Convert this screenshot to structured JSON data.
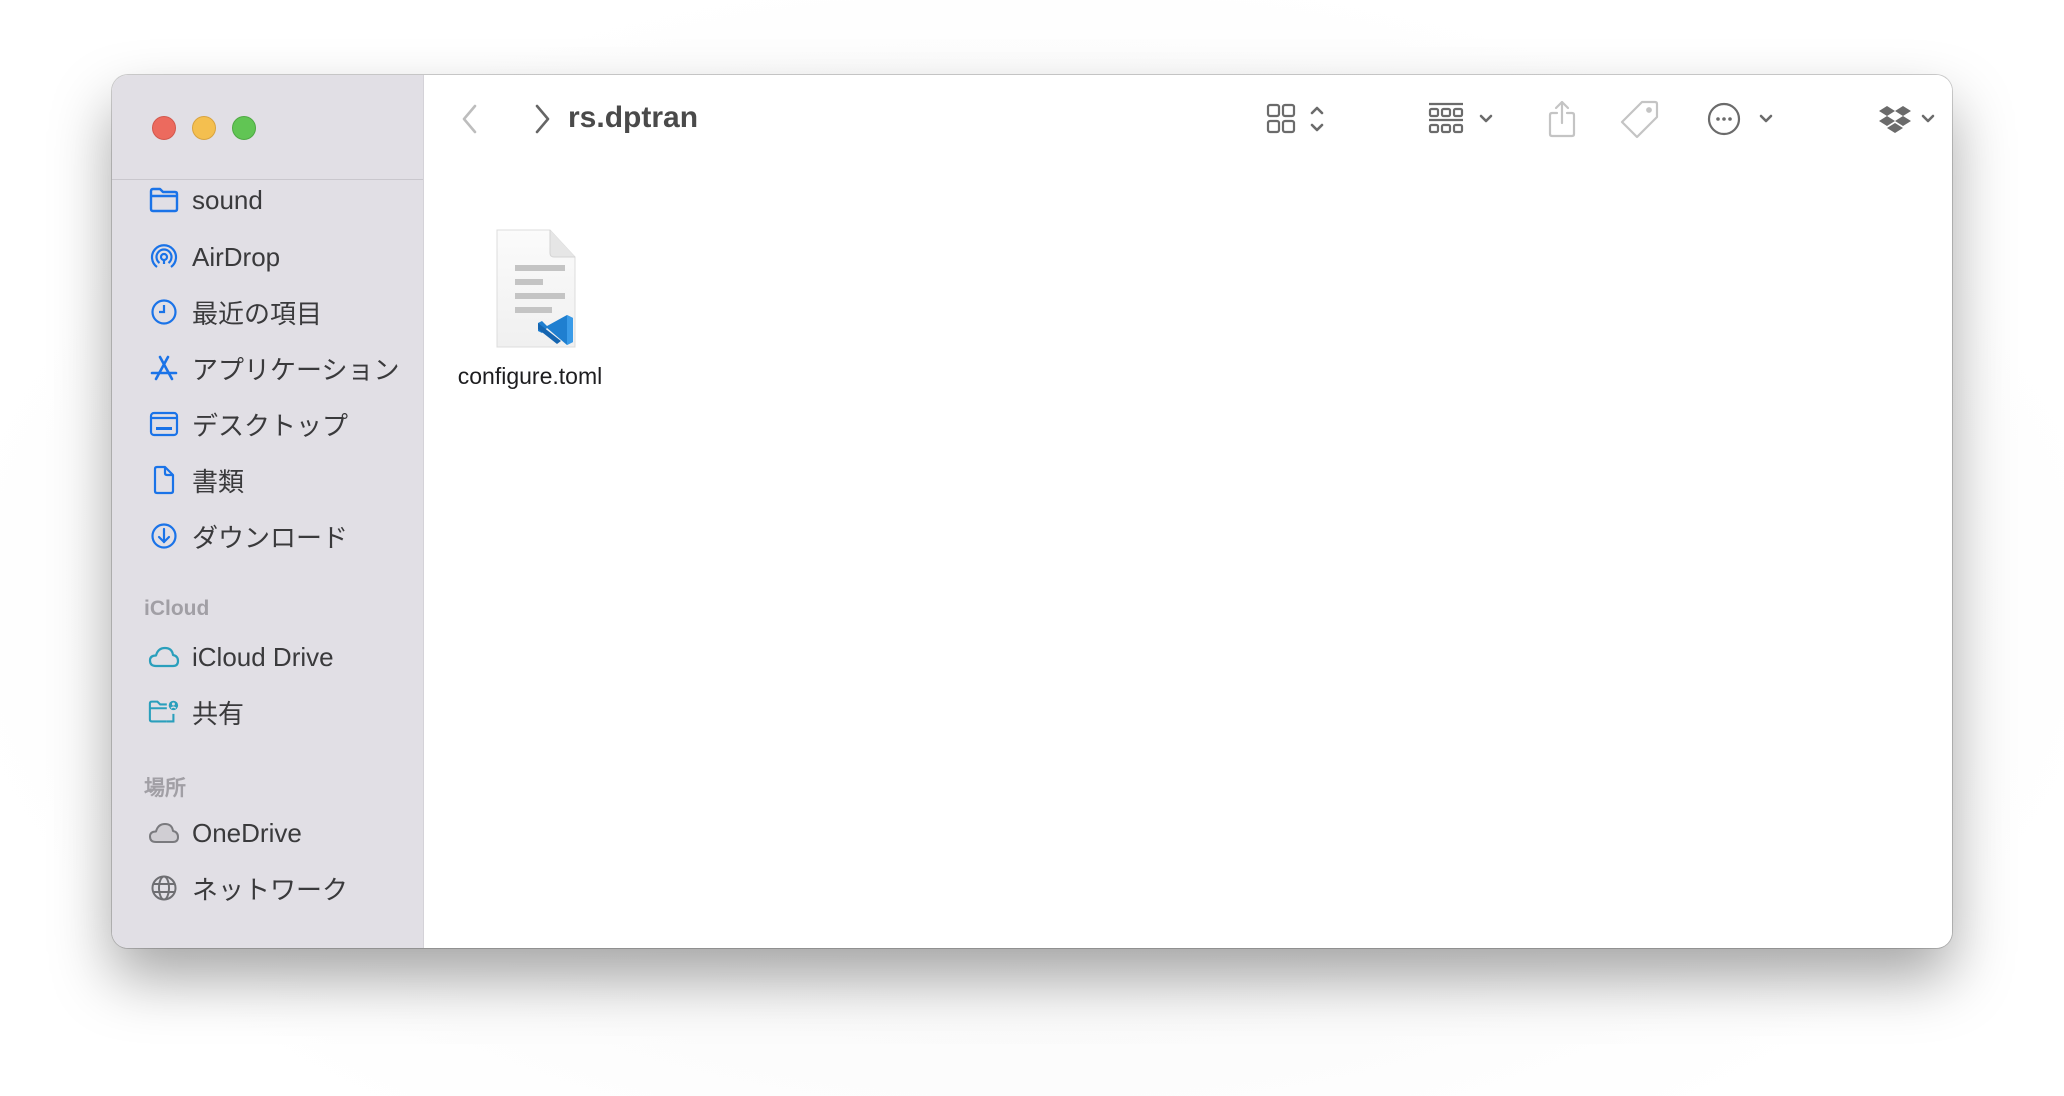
{
  "window": {
    "title": "rs.dptran",
    "traffic_lights": [
      "close",
      "minimize",
      "zoom"
    ]
  },
  "toolbar": {
    "back_icon": "chevron-left-icon",
    "forward_icon": "chevron-right-icon",
    "view_icon": "icon-grid-view-icon",
    "group_icon": "group-by-icon",
    "share_icon": "share-icon",
    "tag_icon": "tag-icon",
    "action_icon": "ellipsis-circle-icon",
    "dropbox_icon": "dropbox-icon",
    "search_icon": "magnifying-glass-icon"
  },
  "sidebar": {
    "items": [
      {
        "label": "sound",
        "icon": "folder-icon"
      },
      {
        "label": "AirDrop",
        "icon": "airdrop-icon"
      },
      {
        "label": "最近の項目",
        "icon": "clock-icon"
      },
      {
        "label": "アプリケーション",
        "icon": "applications-icon"
      },
      {
        "label": "デスクトップ",
        "icon": "desktop-icon"
      },
      {
        "label": "書類",
        "icon": "document-icon"
      },
      {
        "label": "ダウンロード",
        "icon": "download-icon"
      }
    ],
    "icloud_header": "iCloud",
    "icloud_items": [
      {
        "label": "iCloud Drive",
        "icon": "cloud-icon"
      },
      {
        "label": "共有",
        "icon": "shared-folder-icon"
      }
    ],
    "locations_header": "場所",
    "locations_items": [
      {
        "label": "OneDrive",
        "icon": "onedrive-cloud-icon"
      },
      {
        "label": "ネットワーク",
        "icon": "globe-icon"
      }
    ]
  },
  "files": [
    {
      "name": "configure.toml",
      "icon": "vscode-document-icon"
    }
  ],
  "colors": {
    "accent": "#1a73e8",
    "icloud_teal": "#2a9fbc",
    "sidebar_bg": "#e1dfe5"
  }
}
